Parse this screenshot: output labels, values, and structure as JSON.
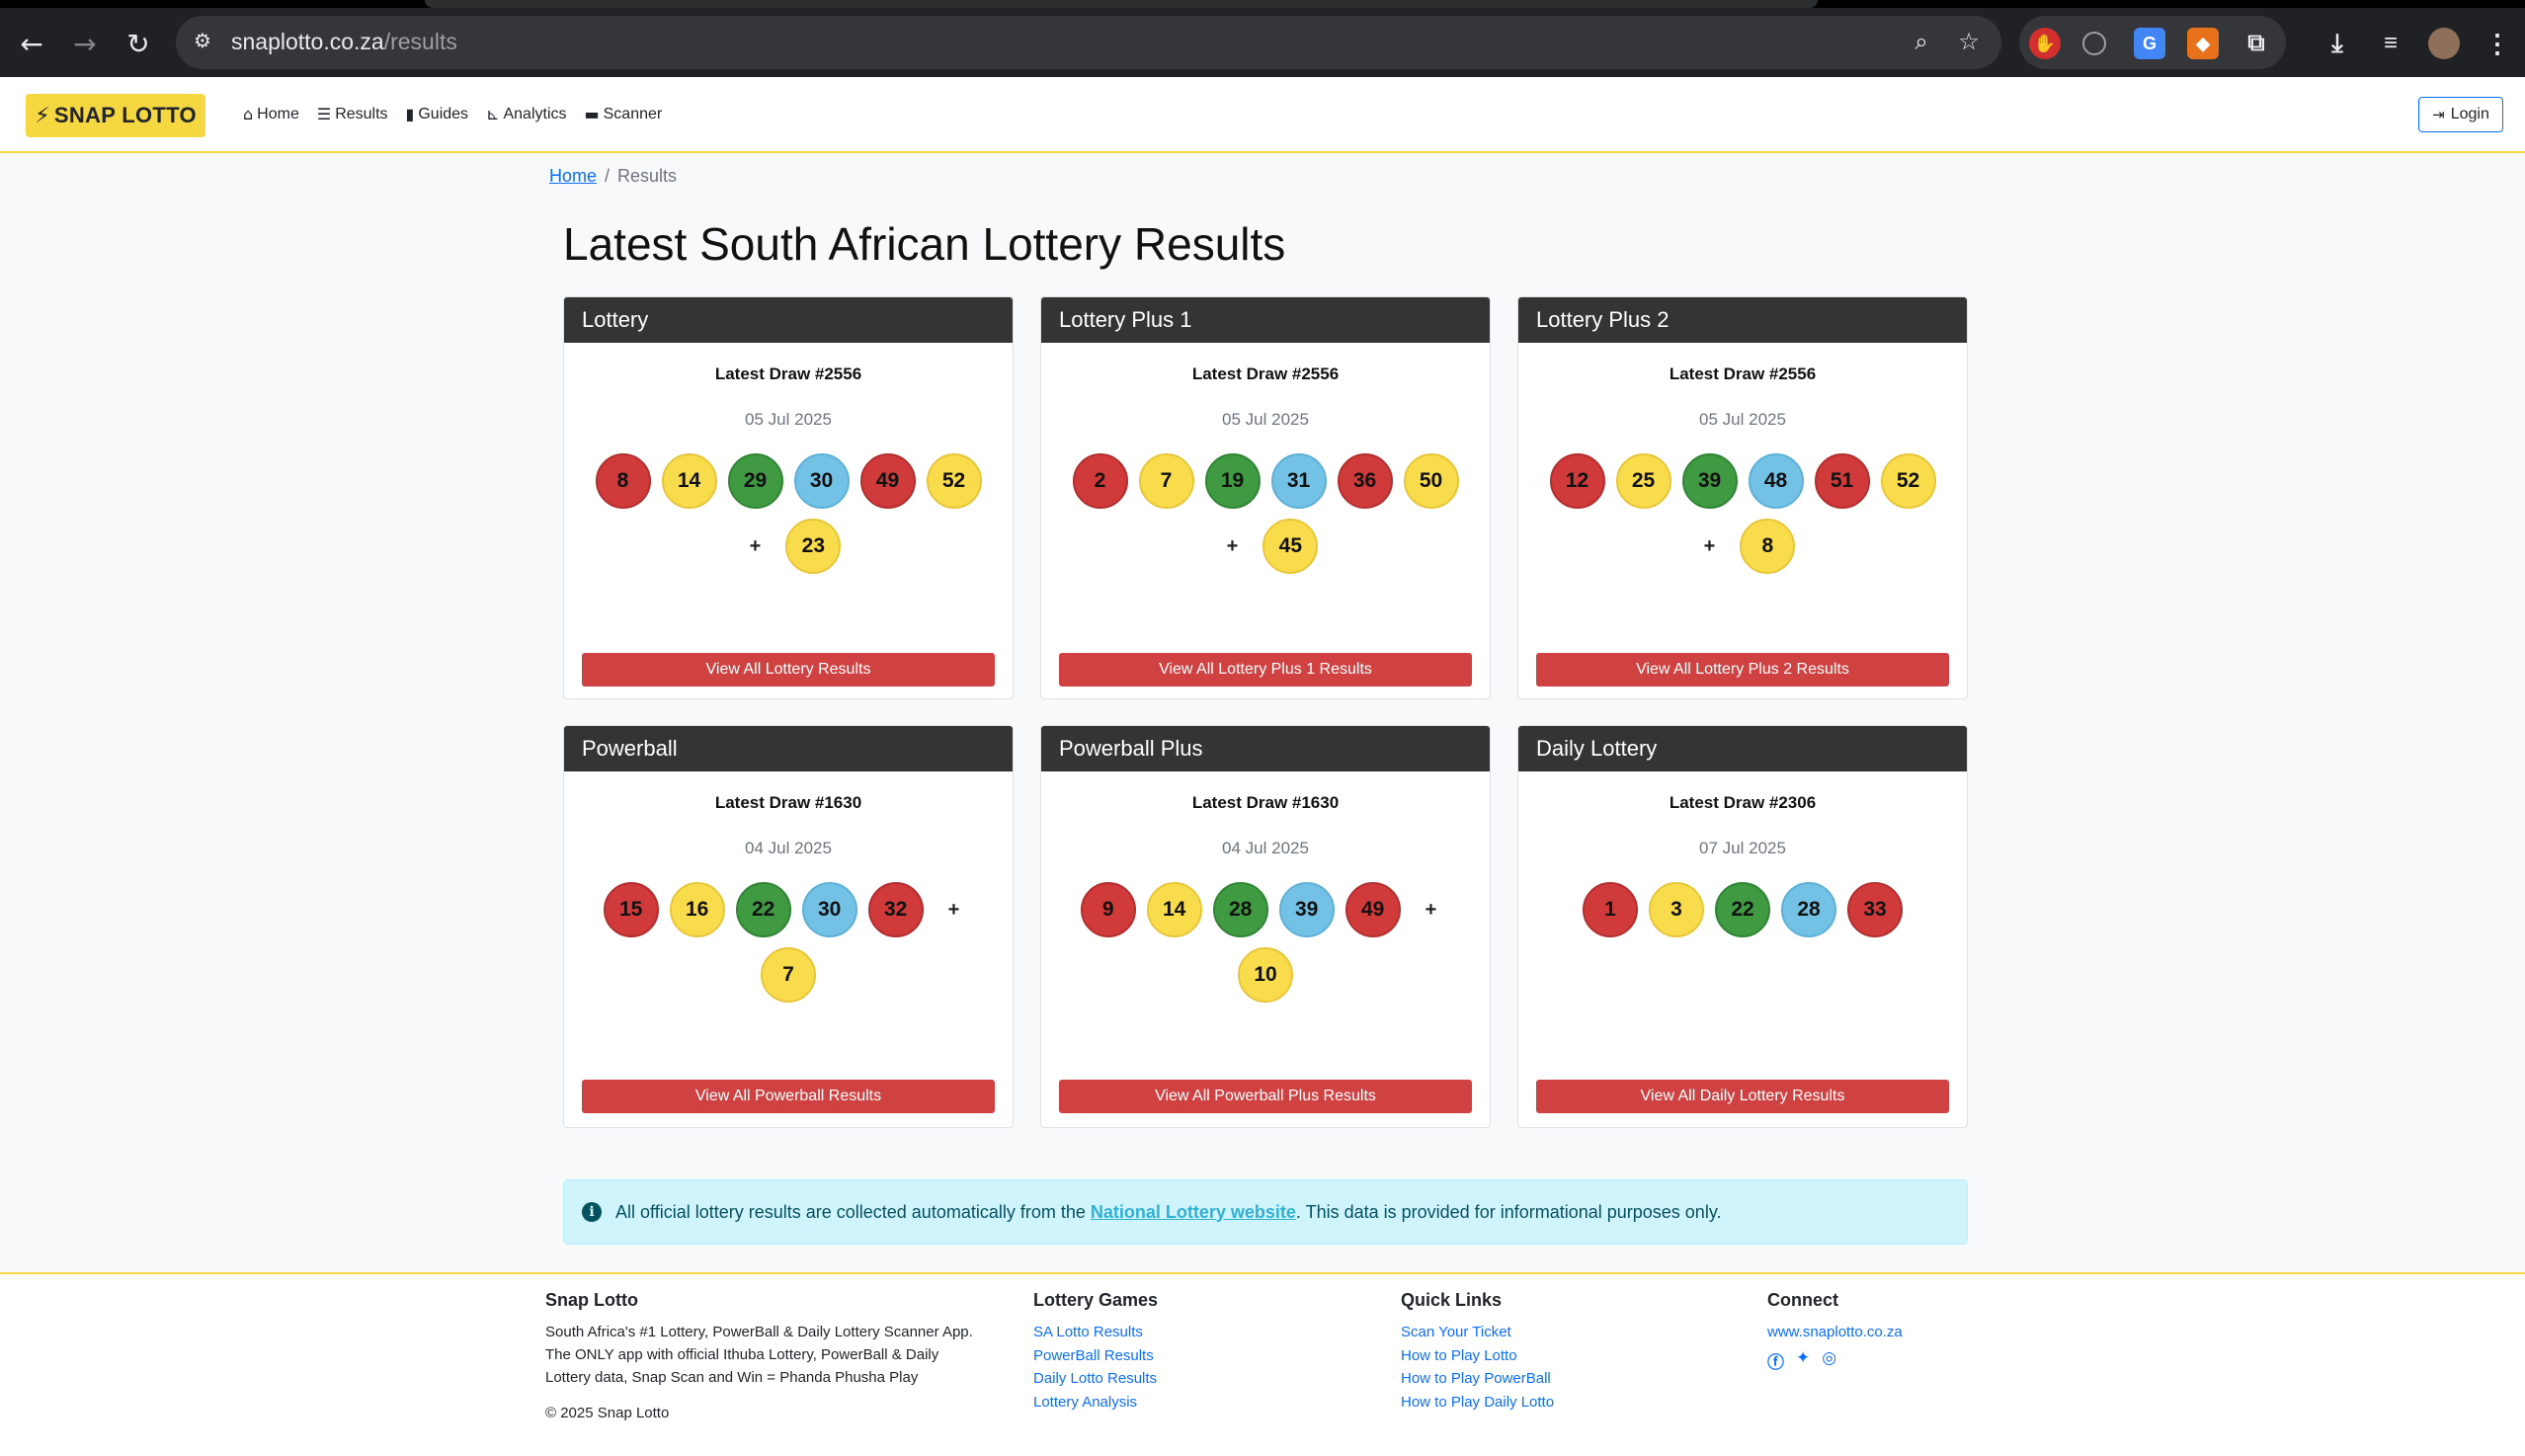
{
  "browser": {
    "url_host": "snaplotto.co.za",
    "url_path": "/results"
  },
  "nav": {
    "brand": "SNAP LOTTO",
    "links": [
      "Home",
      "Results",
      "Guides",
      "Analytics",
      "Scanner"
    ],
    "login": "Login"
  },
  "breadcrumb": {
    "home": "Home",
    "separator": "/",
    "current": "Results"
  },
  "page_title": "Latest South African Lottery Results",
  "cards": [
    {
      "title": "Lottery",
      "draw": "Latest Draw #2556",
      "date": "05 Jul 2025",
      "balls": [
        "8",
        "14",
        "29",
        "30",
        "49",
        "52"
      ],
      "bonus": "23",
      "button": "View All Lottery Results"
    },
    {
      "title": "Lottery Plus 1",
      "draw": "Latest Draw #2556",
      "date": "05 Jul 2025",
      "balls": [
        "2",
        "7",
        "19",
        "31",
        "36",
        "50"
      ],
      "bonus": "45",
      "button": "View All Lottery Plus 1 Results"
    },
    {
      "title": "Lottery Plus 2",
      "draw": "Latest Draw #2556",
      "date": "05 Jul 2025",
      "balls": [
        "12",
        "25",
        "39",
        "48",
        "51",
        "52"
      ],
      "bonus": "8",
      "button": "View All Lottery Plus 2 Results"
    },
    {
      "title": "Powerball",
      "draw": "Latest Draw #1630",
      "date": "04 Jul 2025",
      "balls": [
        "15",
        "16",
        "22",
        "30",
        "32"
      ],
      "bonus": "7",
      "button": "View All Powerball Results"
    },
    {
      "title": "Powerball Plus",
      "draw": "Latest Draw #1630",
      "date": "04 Jul 2025",
      "balls": [
        "9",
        "14",
        "28",
        "39",
        "49"
      ],
      "bonus": "10",
      "button": "View All Powerball Plus Results"
    },
    {
      "title": "Daily Lottery",
      "draw": "Latest Draw #2306",
      "date": "07 Jul 2025",
      "balls": [
        "1",
        "3",
        "22",
        "28",
        "33"
      ],
      "bonus": "",
      "button": "View All Daily Lottery Results"
    }
  ],
  "ball_colors": {
    "red": "#d03a3a",
    "yellow": "#f9dc4c",
    "green": "#3f9a42",
    "blue": "#73c2e6"
  },
  "alert": {
    "text_before": "All official lottery results are collected automatically from the ",
    "link": "National Lottery website",
    "text_after": ". This data is provided for informational purposes only."
  },
  "footer": {
    "about": {
      "heading": "Snap Lotto",
      "line1": "South Africa's #1 Lottery, PowerBall & Daily Lottery Scanner App.",
      "line2": "The ONLY app with official Ithuba Lottery, PowerBall & Daily",
      "line3": "Lottery data, Snap Scan and Win = Phanda Phusha Play",
      "copyright": "© 2025 Snap Lotto"
    },
    "games": {
      "heading": "Lottery Games",
      "links": [
        "SA Lotto Results",
        "PowerBall Results",
        "Daily Lotto Results",
        "Lottery Analysis"
      ]
    },
    "quick": {
      "heading": "Quick Links",
      "links": [
        "Scan Your Ticket",
        "How to Play Lotto",
        "How to Play PowerBall",
        "How to Play Daily Lotto"
      ]
    },
    "connect": {
      "heading": "Connect",
      "site": "www.snaplotto.co.za"
    }
  }
}
